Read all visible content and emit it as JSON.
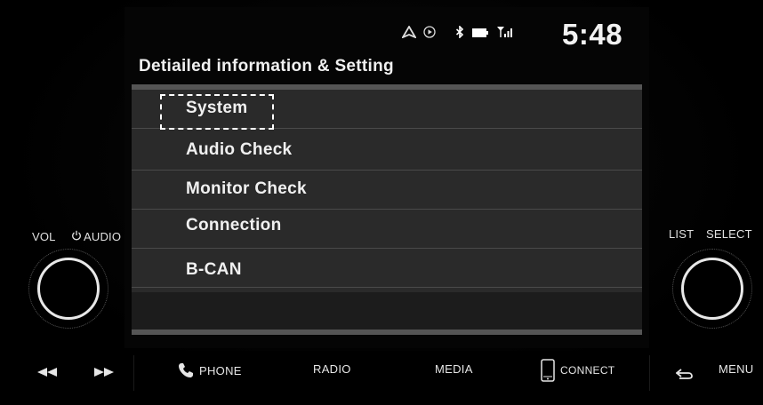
{
  "status_bar": {
    "icons": [
      "navigation-arrow-icon",
      "media-play-icon",
      "bluetooth-icon",
      "battery-icon",
      "signal-icon"
    ],
    "time": "5:48"
  },
  "page": {
    "title": "Detiailed information & Setting"
  },
  "menu": {
    "items": [
      {
        "label": "System",
        "focused": true
      },
      {
        "label": "Audio Check"
      },
      {
        "label": "Monitor Check"
      },
      {
        "label": "Connection"
      },
      {
        "label": "B-CAN"
      }
    ]
  },
  "left_knob": {
    "vol_label": "VOL",
    "audio_label": "AUDIO"
  },
  "right_knob": {
    "list_label": "LIST",
    "select_label": "SELECT"
  },
  "hard_keys": {
    "prev_icon": "seek-back-icon",
    "next_icon": "seek-forward-icon",
    "phone": "PHONE",
    "radio": "RADIO",
    "media": "MEDIA",
    "connect": "CONNECT",
    "back_icon": "back-arrow-icon",
    "menu": "MENU"
  },
  "colors": {
    "focus_outline": "#ffffff",
    "panel_bg": "#2a2a2a",
    "text": "#f0f0f0"
  }
}
